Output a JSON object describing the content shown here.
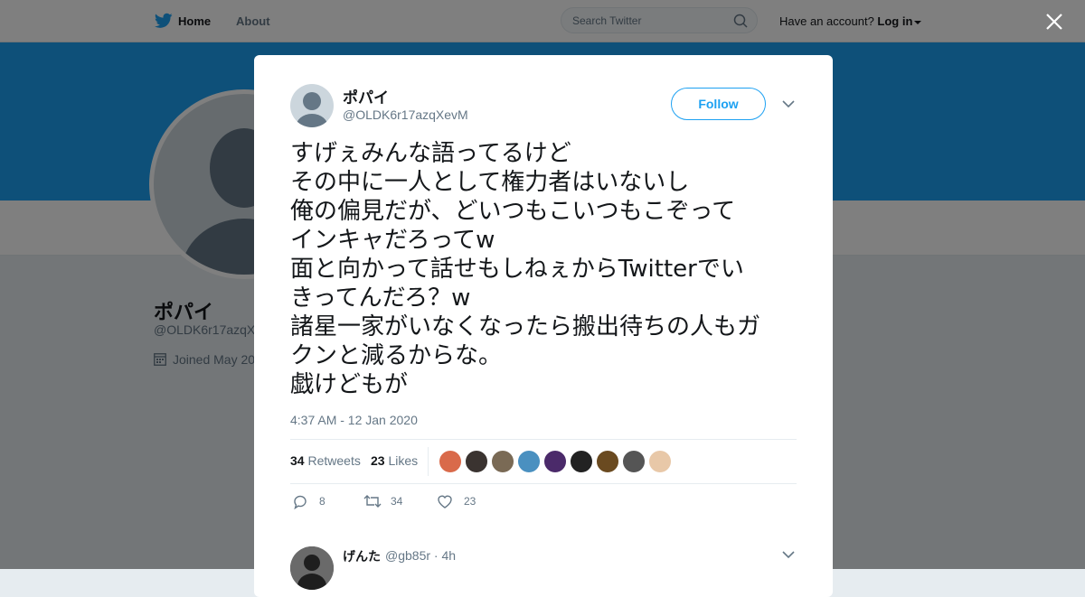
{
  "topbar": {
    "home_label": "Home",
    "about_label": "About",
    "search_placeholder": "Search Twitter",
    "account_prompt": "Have an account?",
    "login_label": "Log in"
  },
  "profile": {
    "name": "ポパイ",
    "handle": "@OLDK6r17azqX",
    "joined": "Joined May 20"
  },
  "tweet": {
    "author_name": "ポパイ",
    "author_handle": "@OLDK6r17azqXevM",
    "follow_label": "Follow",
    "text_lines": [
      "すげぇみんな語ってるけど",
      "その中に一人として権力者はいないし",
      "俺の偏見だが、どいつもこいつもこぞって",
      "インキャだろってw",
      "面と向かって話せもしねぇからTwitterでい",
      "きってんだろ？w",
      "諸星一家がいなくなったら搬出待ちの人もガ",
      "クンと減るからな。",
      "戯けどもが"
    ],
    "timestamp": "4:37 AM - 12 Jan 2020",
    "retweets_count": "34",
    "retweets_label": "Retweets",
    "likes_count": "23",
    "likes_label": "Likes",
    "liker_colors": [
      "#d96a4a",
      "#3a3330",
      "#7a6a55",
      "#4a90c0",
      "#4b2a6a",
      "#222222",
      "#6a4a20",
      "#555555",
      "#e8c8a8"
    ],
    "actions": {
      "reply_count": "8",
      "retweet_count": "34",
      "like_count": "23"
    }
  },
  "reply": {
    "name": "げんた",
    "handle": "@gb85r",
    "age": "4h"
  },
  "colors": {
    "accent": "#1da1f2",
    "banner": "#1da1f2",
    "text_secondary": "#657786"
  }
}
